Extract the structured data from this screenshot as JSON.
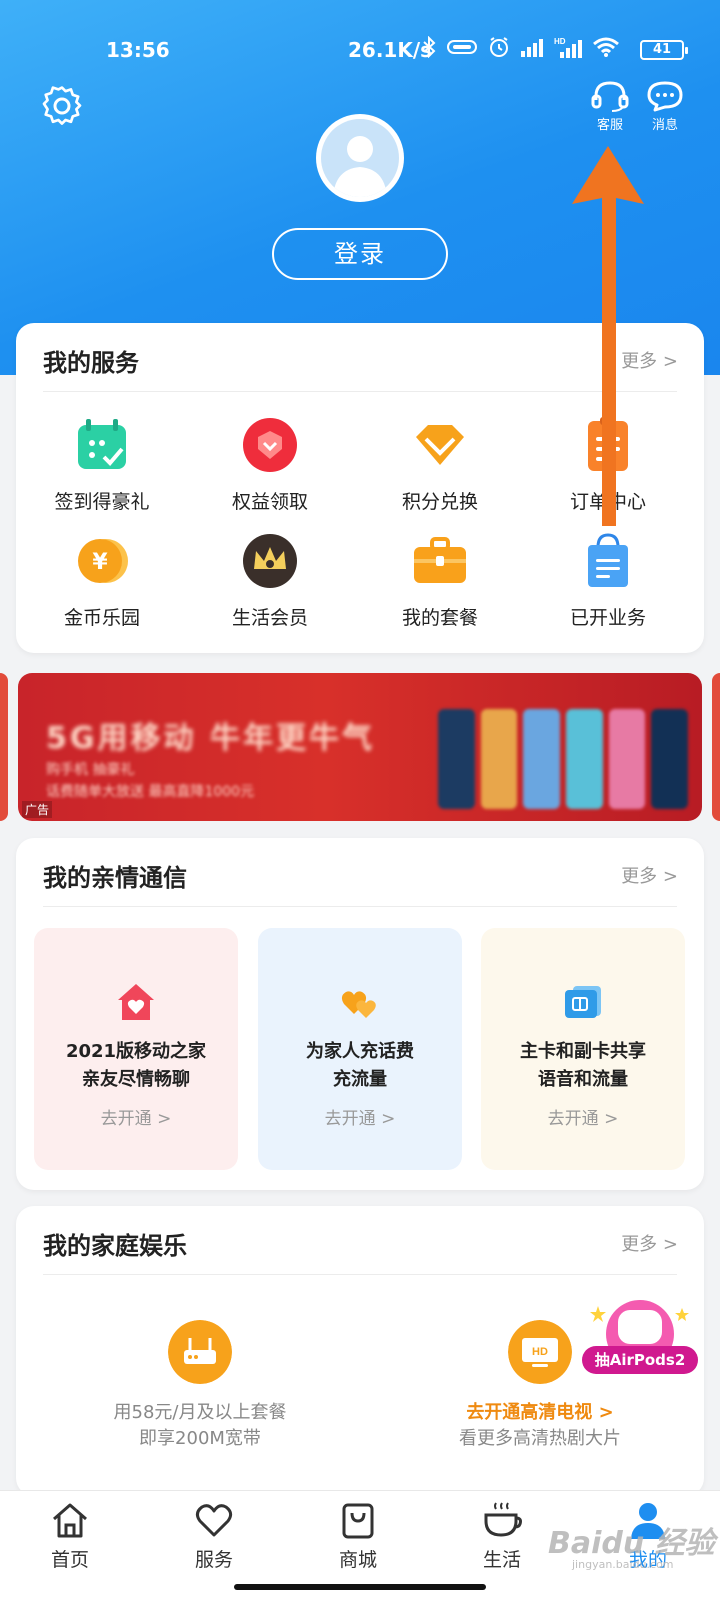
{
  "status_bar": {
    "time": "13:56",
    "network_speed": "26.1K/s",
    "battery": "41",
    "icons": [
      "bluetooth-icon",
      "vibrate-icon",
      "alarm-icon",
      "signal-icon",
      "hd-signal-icon",
      "wifi-icon",
      "battery-icon"
    ]
  },
  "header": {
    "customer_service_label": "客服",
    "messages_label": "消息",
    "login_label": "登录",
    "colors": {
      "top": "#3fb0f8",
      "bottom": "#1a86ee"
    }
  },
  "my_services": {
    "title": "我的服务",
    "more": "更多 >",
    "items": [
      {
        "label": "签到得豪礼",
        "icon": "calendar-check-icon"
      },
      {
        "label": "权益领取",
        "icon": "rights-badge-icon"
      },
      {
        "label": "积分兑换",
        "icon": "diamond-icon"
      },
      {
        "label": "订单中心",
        "icon": "order-list-icon"
      },
      {
        "label": "金币乐园",
        "icon": "gold-coin-icon"
      },
      {
        "label": "生活会员",
        "icon": "crown-icon"
      },
      {
        "label": "我的套餐",
        "icon": "briefcase-icon"
      },
      {
        "label": "已开业务",
        "icon": "shopping-bag-icon"
      }
    ]
  },
  "banner": {
    "title": "5G用移动 牛年更牛气",
    "line1": "购手机 抽豪礼",
    "line2": "话费随单大放送 最高直降1000元",
    "ad_tag": "广告"
  },
  "family": {
    "title": "我的亲情通信",
    "more": "更多 >",
    "cards": [
      {
        "line1": "2021版移动之家",
        "line2": "亲友尽情畅聊",
        "action": "去开通 >",
        "bg": "#fdeeee",
        "icon": "heart-house-icon"
      },
      {
        "line1": "为家人充话费",
        "line2": "充流量",
        "action": "去开通 >",
        "bg": "#eaf3fd",
        "icon": "double-heart-icon"
      },
      {
        "line1": "主卡和副卡共享",
        "line2": "语音和流量",
        "action": "去开通 >",
        "bg": "#fdf8ec",
        "icon": "sim-card-icon"
      }
    ]
  },
  "entertainment": {
    "title": "我的家庭娱乐",
    "more": "更多 >",
    "items": [
      {
        "line1": "用58元/月及以上套餐",
        "line2": "即享200M宽带",
        "icon": "router-icon"
      },
      {
        "line1": "去开通高清电视 >",
        "line2": "看更多高清热剧大片",
        "icon": "hd-tv-icon"
      }
    ],
    "promo": "抽AirPods2"
  },
  "tabbar": {
    "tabs": [
      {
        "label": "首页",
        "icon": "home-icon"
      },
      {
        "label": "服务",
        "icon": "heart-icon"
      },
      {
        "label": "商城",
        "icon": "bag-icon"
      },
      {
        "label": "生活",
        "icon": "coffee-cup-icon"
      },
      {
        "label": "我的",
        "icon": "user-icon",
        "active": true
      }
    ],
    "active_color": "#1e8ef0"
  },
  "annotation": {
    "color": "#f07420"
  },
  "watermark": {
    "text": "Baidu 经验",
    "sub": "jingyan.baidu.com"
  }
}
